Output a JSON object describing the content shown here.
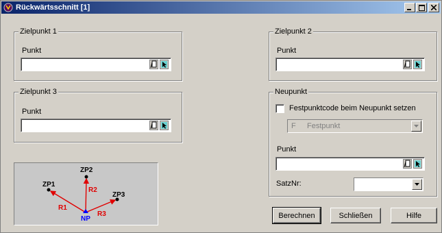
{
  "window": {
    "title": "Rückwärtsschnitt [1]"
  },
  "groups": {
    "zielpunkt1": {
      "legend": "Zielpunkt 1",
      "label": "Punkt",
      "value": ""
    },
    "zielpunkt2": {
      "legend": "Zielpunkt 2",
      "label": "Punkt",
      "value": ""
    },
    "zielpunkt3": {
      "legend": "Zielpunkt 3",
      "label": "Punkt",
      "value": ""
    },
    "neupunkt": {
      "legend": "Neupunkt",
      "checkbox_label": "Festpunktcode beim Neupunkt setzen",
      "checkbox_checked": false,
      "code_select": {
        "code": "F",
        "text": "Festpunkt",
        "disabled": true
      },
      "punkt_label": "Punkt",
      "punkt_value": "",
      "satznr_label": "SatzNr:",
      "satznr_value": ""
    }
  },
  "diagram": {
    "labels": {
      "zp1": "ZP1",
      "zp2": "ZP2",
      "zp3": "ZP3",
      "np": "NP",
      "r1": "R1",
      "r2": "R2",
      "r3": "R3"
    },
    "colors": {
      "ray": "#e00000",
      "np": "#0000ff",
      "point": "#000000",
      "background": "#c8c8c8"
    }
  },
  "buttons": {
    "berechnen": "Berechnen",
    "schliessen": "Schließen",
    "hilfe": "Hilfe"
  },
  "icons": {
    "field_button_1": "clipboard-icon",
    "field_button_2": "pick-cursor-icon",
    "dropdown": "chevron-down-icon"
  }
}
